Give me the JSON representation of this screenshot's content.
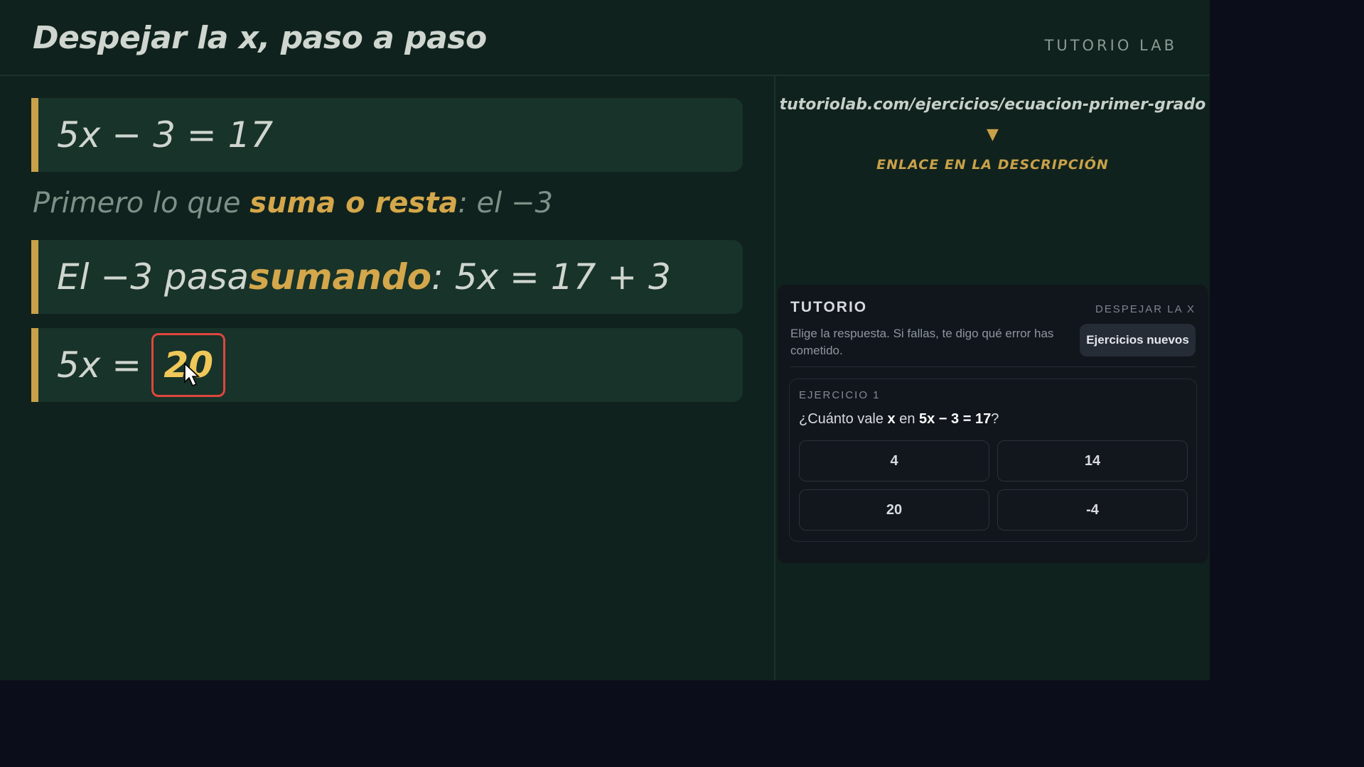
{
  "header": {
    "title": "Despejar la x, paso a paso",
    "brand": "TUTORIO LAB"
  },
  "steps": {
    "eq1": "5x − 3 = 17",
    "note_prefix": "Primero lo que ",
    "note_highlight": "suma o resta",
    "note_suffix": ": el −3",
    "eq2_prefix": "El −3 pasa ",
    "eq2_highlight": "sumando",
    "eq2_suffix": ": 5x = 17 + 3",
    "eq3_prefix": "5x = ",
    "eq3_answer": "20"
  },
  "promo": {
    "url": "tutoriolab.com/ejercicios/ecuacion-primer-grado",
    "arrow": "▼",
    "link_note": "ENLACE EN LA DESCRIPCIÓN"
  },
  "panel": {
    "title": "TUTORIO",
    "tag": "DESPEJAR LA X",
    "description": "Elige la respuesta. Si fallas, te digo qué error has cometido.",
    "new_button": "Ejercicios nuevos",
    "exercise_label": "EJERCICIO 1",
    "question": {
      "q1": "¿Cuánto vale ",
      "var": "x",
      "q2": " en ",
      "equation": "5x − 3 = 17",
      "q3": "?"
    },
    "options": [
      "4",
      "14",
      "20",
      "-4"
    ]
  },
  "colors": {
    "background": "#10221d",
    "accent": "#c9a14a",
    "answer_highlight": "#f0c859",
    "answer_border": "#e0463e"
  }
}
